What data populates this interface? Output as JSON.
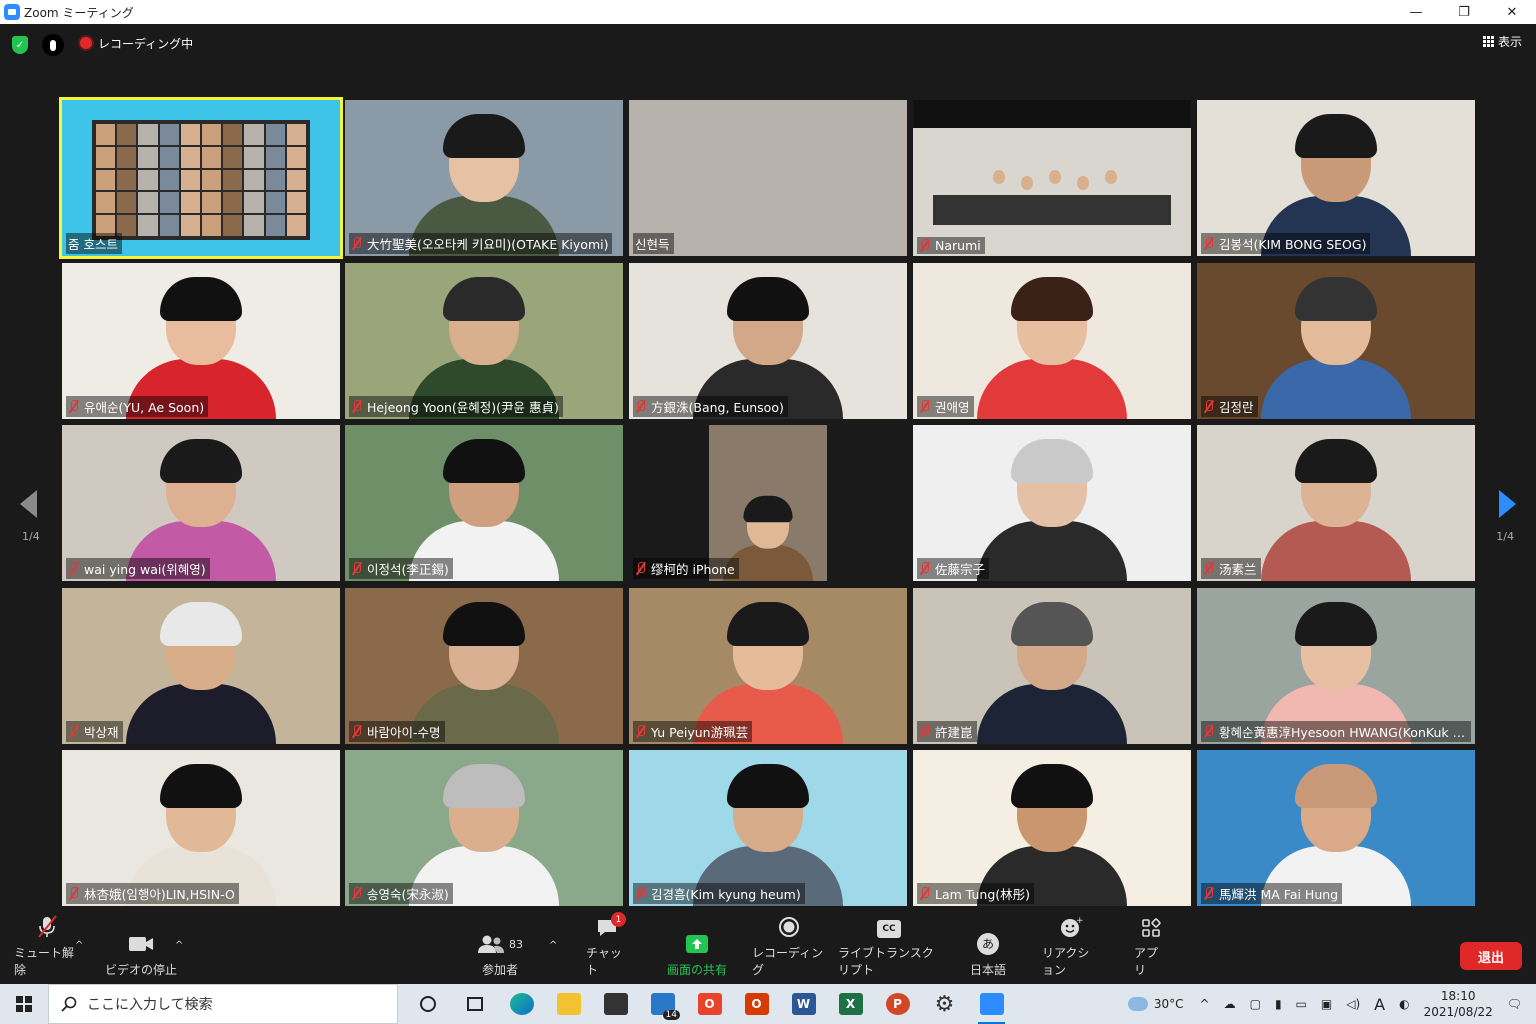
{
  "window": {
    "title": "Zoom ミーティング",
    "minimize": "—",
    "maximize": "❐",
    "close": "✕"
  },
  "topbar": {
    "recording_label": "レコーディング中",
    "view_label": "表示"
  },
  "pager": {
    "left_page": "1/4",
    "right_page": "1/4"
  },
  "participants": [
    {
      "name": "줌 호스트",
      "muted": false,
      "active": true,
      "bg": "#3ec4e8",
      "shirt": "#333",
      "hair": "#222",
      "skin": "#e2b996",
      "kind": "screen"
    },
    {
      "name": "大竹聖美(오오타케 키요미)(OTAKE Kiyomi)",
      "muted": true,
      "bg": "#8a9aa6",
      "shirt": "#4a5a42",
      "hair": "#1a1a1a",
      "skin": "#e7c1a3"
    },
    {
      "name": "신현득",
      "muted": false,
      "bg": "#b8b2ac",
      "shirt": "#b8b2ac",
      "hair": "#b8b2ac",
      "skin": "#b8b2ac",
      "kind": "empty"
    },
    {
      "name": "Narumi",
      "muted": true,
      "bg": "#d9d6cf",
      "shirt": "#444",
      "hair": "#333",
      "skin": "#dbb999",
      "kind": "room"
    },
    {
      "name": "김봉석(KIM BONG SEOG)",
      "muted": true,
      "bg": "#e4e0d8",
      "shirt": "#243554",
      "hair": "#1a1a1a",
      "skin": "#c89a78"
    },
    {
      "name": "유애순(YU, Ae Soon)",
      "muted": true,
      "bg": "#efece6",
      "shirt": "#d8242c",
      "hair": "#111",
      "skin": "#e8bc9c"
    },
    {
      "name": "Hejeong Yoon(윤혜정)(尹윤 惠貞)",
      "muted": true,
      "bg": "#9aa57a",
      "shirt": "#2e4a2a",
      "hair": "#2a2a2a",
      "skin": "#d9b08e"
    },
    {
      "name": "方銀洙(Bang, Eunsoo)",
      "muted": true,
      "bg": "#e6e2dc",
      "shirt": "#2a2a2a",
      "hair": "#111",
      "skin": "#d2a888"
    },
    {
      "name": "권애영",
      "muted": true,
      "bg": "#efe8df",
      "shirt": "#e23a3a",
      "hair": "#3a2218",
      "skin": "#e7bea0"
    },
    {
      "name": "김정란",
      "muted": true,
      "bg": "#6a4a2e",
      "shirt": "#3a68a8",
      "hair": "#333",
      "skin": "#e3bb9b"
    },
    {
      "name": "wai ying wai(위혜영)",
      "muted": true,
      "bg": "#cfc9c1",
      "shirt": "#c25aa6",
      "hair": "#1a1a1a",
      "skin": "#dcb090"
    },
    {
      "name": "이정석(李正錫)",
      "muted": true,
      "bg": "#6f8f68",
      "shirt": "#f2f2f2",
      "hair": "#111",
      "skin": "#cfa07f"
    },
    {
      "name": "缪柯的 iPhone",
      "muted": true,
      "bg": "#1a1a1a",
      "shirt": "#7a5a3a",
      "hair": "#1a1a1a",
      "skin": "#e1b895",
      "kind": "phone"
    },
    {
      "name": "佐藤宗子",
      "muted": true,
      "bg": "#efefef",
      "shirt": "#2a2a2a",
      "hair": "#c9c9c9",
      "skin": "#e4c0a6"
    },
    {
      "name": "汤素兰",
      "muted": true,
      "bg": "#d8d4cc",
      "shirt": "#b45a52",
      "hair": "#1a1a1a",
      "skin": "#ddb395"
    },
    {
      "name": "박상재",
      "muted": true,
      "bg": "#c4b49a",
      "shirt": "#1c1c2a",
      "hair": "#e8e8e8",
      "skin": "#d8ae8a"
    },
    {
      "name": "바람아이-수명",
      "muted": true,
      "bg": "#8a6a4a",
      "shirt": "#6a6a4a",
      "hair": "#111",
      "skin": "#d9b091"
    },
    {
      "name": "Yu Peiyun游珮芸",
      "muted": true,
      "bg": "#a68a66",
      "shirt": "#e85a4a",
      "hair": "#1a1a1a",
      "skin": "#e6bb9a"
    },
    {
      "name": "許建崑",
      "muted": true,
      "bg": "#c9c3b8",
      "shirt": "#1c2436",
      "hair": "#555",
      "skin": "#d3a98a"
    },
    {
      "name": "황혜순黃惠淳Hyesoon HWANG(KonKuk U...",
      "muted": true,
      "bg": "#9aa5a0",
      "shirt": "#f0b8b0",
      "hair": "#1a1a1a",
      "skin": "#e7c0a4"
    },
    {
      "name": "林杏娥(임행아)LIN,HSIN-O",
      "muted": true,
      "bg": "#eae7e1",
      "shirt": "#e8e2d8",
      "hair": "#111",
      "skin": "#e2b998"
    },
    {
      "name": "송영숙(宋永淑)",
      "muted": true,
      "bg": "#8aa88a",
      "shirt": "#f2f2f2",
      "hair": "#bdbdbd",
      "skin": "#dbae8e"
    },
    {
      "name": "김경흠(Kim kyung heum)",
      "muted": true,
      "bg": "#9fd8e8",
      "shirt": "#5a6a7a",
      "hair": "#111",
      "skin": "#d6ab8a"
    },
    {
      "name": "Lam Tung(林彤)",
      "muted": true,
      "bg": "#f4efe2",
      "shirt": "#2a2a2a",
      "hair": "#111",
      "skin": "#c9966f"
    },
    {
      "name": "馬輝洪 MA Fai Hung",
      "muted": true,
      "bg": "#3a8ac8",
      "shirt": "#f2f2f2",
      "hair": "#c89a7a",
      "skin": "#d9a988"
    }
  ],
  "toolbar": {
    "unmute": "ミュート解除",
    "stop_video": "ビデオの停止",
    "participants": "参加者",
    "participants_count": "83",
    "chat": "チャット",
    "chat_badge": "1",
    "share": "画面の共有",
    "record": "レコーディング",
    "transcript": "ライブトランスクリプト",
    "language": "日本語",
    "language_icon": "あ",
    "reaction": "リアクション",
    "apps": "アプリ",
    "leave": "退出",
    "cc": "CC"
  },
  "taskbar": {
    "search_placeholder": "ここに入力して検索",
    "mail_badge": "14",
    "temperature": "30°C",
    "time": "18:10",
    "date": "2021/08/22",
    "ime": "A"
  }
}
